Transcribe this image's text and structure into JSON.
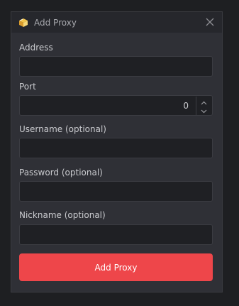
{
  "window": {
    "title": "Add Proxy",
    "app_icon": "box-icon",
    "close_icon": "close-icon"
  },
  "form": {
    "address": {
      "label": "Address",
      "value": "",
      "placeholder": ""
    },
    "port": {
      "label": "Port",
      "value": "0",
      "stepper_up_icon": "chevron-up-icon",
      "stepper_down_icon": "chevron-down-icon"
    },
    "username": {
      "label": "Username (optional)",
      "value": "",
      "placeholder": ""
    },
    "password": {
      "label": "Password (optional)",
      "value": "",
      "placeholder": ""
    },
    "nickname": {
      "label": "Nickname (optional)",
      "value": "",
      "placeholder": ""
    },
    "submit_label": "Add Proxy"
  },
  "colors": {
    "accent": "#ee464a",
    "background": "#2f3036",
    "field_background": "#1f2024"
  }
}
